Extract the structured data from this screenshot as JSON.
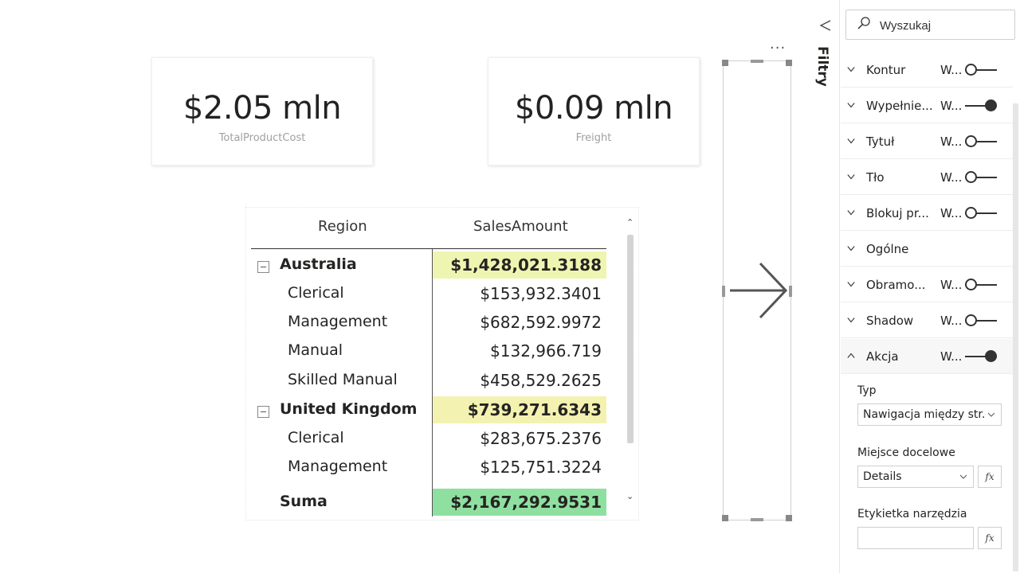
{
  "cards": [
    {
      "value": "$2.05 mln",
      "label": "TotalProductCost"
    },
    {
      "value": "$0.09 mln",
      "label": "Freight"
    }
  ],
  "matrix": {
    "headers": [
      "Region",
      "SalesAmount"
    ],
    "rows": [
      {
        "label": "Australia",
        "value": "$1,428,021.3188",
        "type": "group",
        "highlight": "#eef5b0"
      },
      {
        "label": "Clerical",
        "value": "$153,932.3401",
        "type": "child"
      },
      {
        "label": "Management",
        "value": "$682,592.9972",
        "type": "child"
      },
      {
        "label": "Manual",
        "value": "$132,966.719",
        "type": "child"
      },
      {
        "label": "Skilled Manual",
        "value": "$458,529.2625",
        "type": "child"
      },
      {
        "label": "United Kingdom",
        "value": "$739,271.6343",
        "type": "group",
        "highlight": "#f4f2b0"
      },
      {
        "label": "Clerical",
        "value": "$283,675.2376",
        "type": "child"
      },
      {
        "label": "Management",
        "value": "$125,751.3224",
        "type": "child"
      },
      {
        "label": "Suma",
        "value": "$2,167,292.9531",
        "type": "total",
        "highlight": "#8fe0a0"
      }
    ]
  },
  "filters": {
    "label": "Filtry"
  },
  "pane": {
    "search_placeholder": "Wyszukaj",
    "sections": [
      {
        "name": "Kontur",
        "value": "W...",
        "toggle": "off",
        "expanded": false
      },
      {
        "name": "Wypełnie...",
        "value": "W...",
        "toggle": "on",
        "expanded": false
      },
      {
        "name": "Tytuł",
        "value": "W...",
        "toggle": "off",
        "expanded": false
      },
      {
        "name": "Tło",
        "value": "W...",
        "toggle": "off",
        "expanded": false
      },
      {
        "name": "Blokuj pr...",
        "value": "W...",
        "toggle": "off",
        "expanded": false
      },
      {
        "name": "Ogólne",
        "value": "",
        "toggle": "none",
        "expanded": false
      },
      {
        "name": "Obramo...",
        "value": "W...",
        "toggle": "off",
        "expanded": false
      },
      {
        "name": "Shadow",
        "value": "W...",
        "toggle": "off",
        "expanded": false
      },
      {
        "name": "Akcja",
        "value": "W...",
        "toggle": "on",
        "expanded": true
      }
    ],
    "type_label": "Typ",
    "type_value": "Nawigacja między str...",
    "dest_label": "Miejsce docelowe",
    "dest_value": "Details",
    "tooltip_label": "Etykietka narzędzia",
    "fx_label": "fx"
  },
  "colors": {
    "accent": "#252423",
    "total_highlight": "#8fe0a0"
  }
}
